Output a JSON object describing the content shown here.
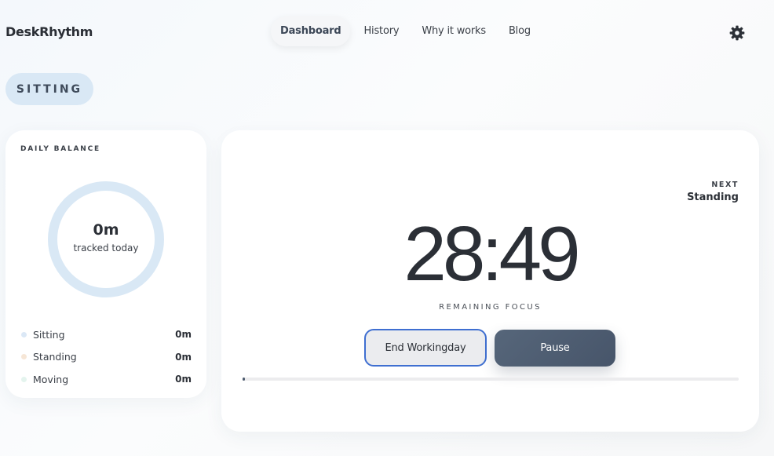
{
  "app": {
    "brand": "DeskRhythm"
  },
  "nav": {
    "items": [
      {
        "label": "Dashboard",
        "active": true
      },
      {
        "label": "History",
        "active": false
      },
      {
        "label": "Why it works",
        "active": false
      },
      {
        "label": "Blog",
        "active": false
      }
    ]
  },
  "header": {
    "settings_icon": "gear-icon"
  },
  "state": {
    "label": "SITTING"
  },
  "balance": {
    "title": "DAILY BALANCE",
    "total": "0m",
    "total_label": "tracked today",
    "ring_color": "#d9e8f5",
    "items": [
      {
        "label": "Sitting",
        "value": "0m",
        "color": "#dbe8f6"
      },
      {
        "label": "Standing",
        "value": "0m",
        "color": "#f6e6d6"
      },
      {
        "label": "Moving",
        "value": "0m",
        "color": "#e4f4ee"
      }
    ]
  },
  "timer": {
    "next_label": "NEXT",
    "next_value": "Standing",
    "time": "28:49",
    "caption": "REMAINING FOCUS",
    "end_label": "End Workingday",
    "pause_label": "Pause",
    "progress_percent": 0.4
  },
  "colors": {
    "accent": "#3f6fd1",
    "primary_button": "#4d5b6e",
    "state_pill": "#d9e8f5"
  }
}
